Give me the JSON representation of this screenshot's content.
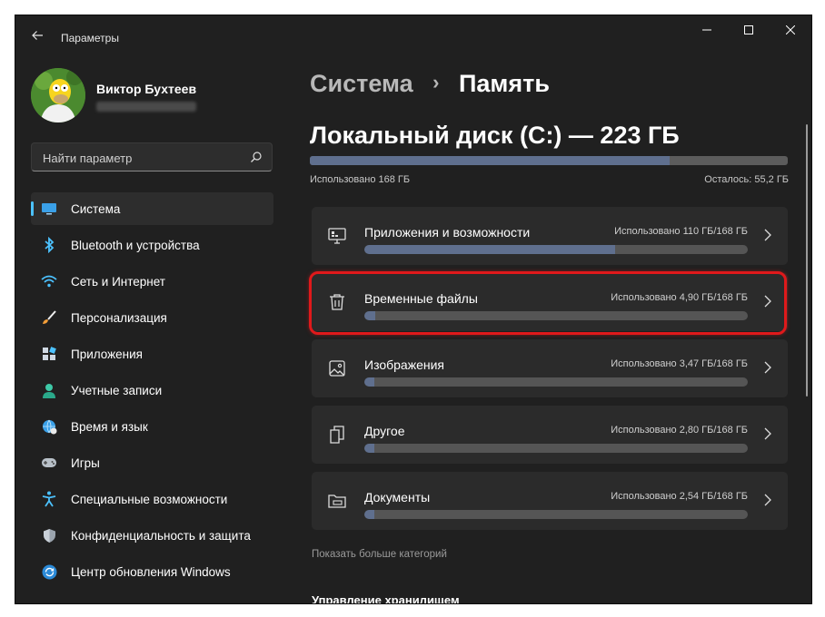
{
  "window": {
    "title": "Параметры"
  },
  "profile": {
    "name": "Виктор Бухтеев"
  },
  "search": {
    "placeholder": "Найти параметр"
  },
  "sidebar": {
    "items": [
      {
        "label": "Система",
        "icon": "display-icon",
        "active": true
      },
      {
        "label": "Bluetooth и устройства",
        "icon": "bluetooth-icon"
      },
      {
        "label": "Сеть и Интернет",
        "icon": "wifi-icon"
      },
      {
        "label": "Персонализация",
        "icon": "brush-icon"
      },
      {
        "label": "Приложения",
        "icon": "apps-icon"
      },
      {
        "label": "Учетные записи",
        "icon": "person-icon"
      },
      {
        "label": "Время и язык",
        "icon": "globe-clock-icon"
      },
      {
        "label": "Игры",
        "icon": "gamepad-icon"
      },
      {
        "label": "Специальные возможности",
        "icon": "accessibility-icon"
      },
      {
        "label": "Конфиденциальность и защита",
        "icon": "shield-icon"
      },
      {
        "label": "Центр обновления Windows",
        "icon": "update-icon"
      }
    ]
  },
  "breadcrumb": {
    "parent": "Система",
    "separator": "›",
    "current": "Память"
  },
  "disk": {
    "title": "Локальный диск (C:) — 223 ГБ",
    "used_label": "Использовано 168 ГБ",
    "free_label": "Осталось: 55,2 ГБ",
    "used_fraction": 0.753
  },
  "categories": [
    {
      "title": "Приложения и возможности",
      "usage": "Использовано 110 ГБ/168 ГБ",
      "fraction": 0.655,
      "icon": "apps-features-icon"
    },
    {
      "title": "Временные файлы",
      "usage": "Использовано 4,90 ГБ/168 ГБ",
      "fraction": 0.029,
      "icon": "trash-icon"
    },
    {
      "title": "Изображения",
      "usage": "Использовано 3,47 ГБ/168 ГБ",
      "fraction": 0.021,
      "icon": "image-icon"
    },
    {
      "title": "Другое",
      "usage": "Использовано 2,80 ГБ/168 ГБ",
      "fraction": 0.017,
      "icon": "document-other-icon"
    },
    {
      "title": "Документы",
      "usage": "Использовано 2,54 ГБ/168 ГБ",
      "fraction": 0.015,
      "icon": "folder-icon"
    }
  ],
  "links": {
    "more_categories": "Показать больше категорий"
  },
  "sections": {
    "storage_management": "Управление хранилищем"
  },
  "colors": {
    "accent": "#4cc2ff",
    "bar_fill": "#5f6f8e",
    "highlight": "#e0191b",
    "background": "#202020",
    "card": "#2b2b2b"
  }
}
